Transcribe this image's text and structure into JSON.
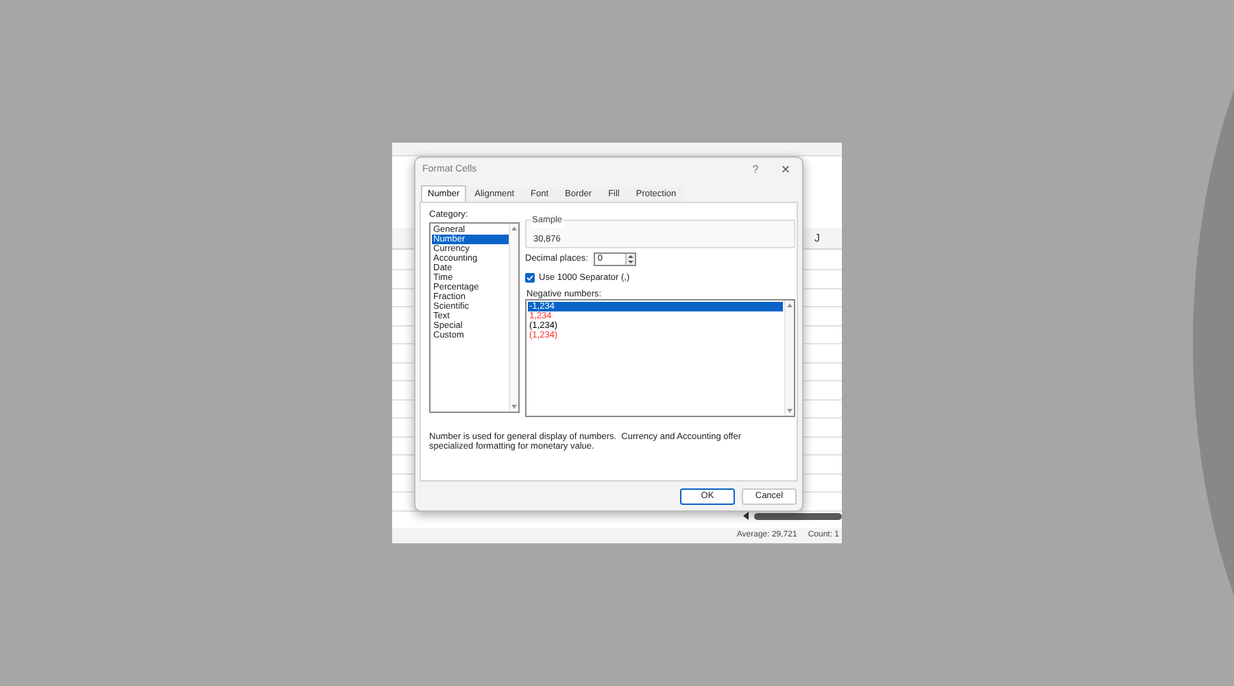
{
  "spreadsheet": {
    "column_header": "J",
    "status_bar": {
      "average": "Average: 29,721",
      "count": "Count: 1"
    }
  },
  "dialog": {
    "title": "Format Cells",
    "help": "?",
    "close": "×",
    "tabs": [
      {
        "label": "Number",
        "selected": true
      },
      {
        "label": "Alignment",
        "selected": false
      },
      {
        "label": "Font",
        "selected": false
      },
      {
        "label": "Border",
        "selected": false
      },
      {
        "label": "Fill",
        "selected": false
      },
      {
        "label": "Protection",
        "selected": false
      }
    ],
    "category": {
      "label": "Category:",
      "items": [
        {
          "label": "General",
          "selected": false
        },
        {
          "label": "Number",
          "selected": true
        },
        {
          "label": "Currency",
          "selected": false
        },
        {
          "label": "Accounting",
          "selected": false
        },
        {
          "label": "Date",
          "selected": false
        },
        {
          "label": "Time",
          "selected": false
        },
        {
          "label": "Percentage",
          "selected": false
        },
        {
          "label": "Fraction",
          "selected": false
        },
        {
          "label": "Scientific",
          "selected": false
        },
        {
          "label": "Text",
          "selected": false
        },
        {
          "label": "Special",
          "selected": false
        },
        {
          "label": "Custom",
          "selected": false
        }
      ]
    },
    "sample": {
      "label": "Sample",
      "value": "30,876"
    },
    "decimal_places": {
      "label": "Decimal places:",
      "value": "0"
    },
    "separator": {
      "label": "Use 1000 Separator (,)",
      "checked": true
    },
    "negative_numbers": {
      "label": "Negative numbers:",
      "items": [
        {
          "label": "-1,234",
          "selected": true
        },
        {
          "label": "1,234",
          "color": "#ff3030",
          "selected": false
        },
        {
          "label": "(1,234)",
          "color": "#000000",
          "selected": false
        },
        {
          "label": "(1,234)",
          "color": "#ff3030",
          "selected": false
        }
      ]
    },
    "description": "Number is used for general display of numbers.  Currency and Accounting offer specialized formatting for monetary value.",
    "buttons": [
      {
        "label": "OK",
        "default": true
      },
      {
        "label": "Cancel",
        "default": false
      }
    ]
  }
}
